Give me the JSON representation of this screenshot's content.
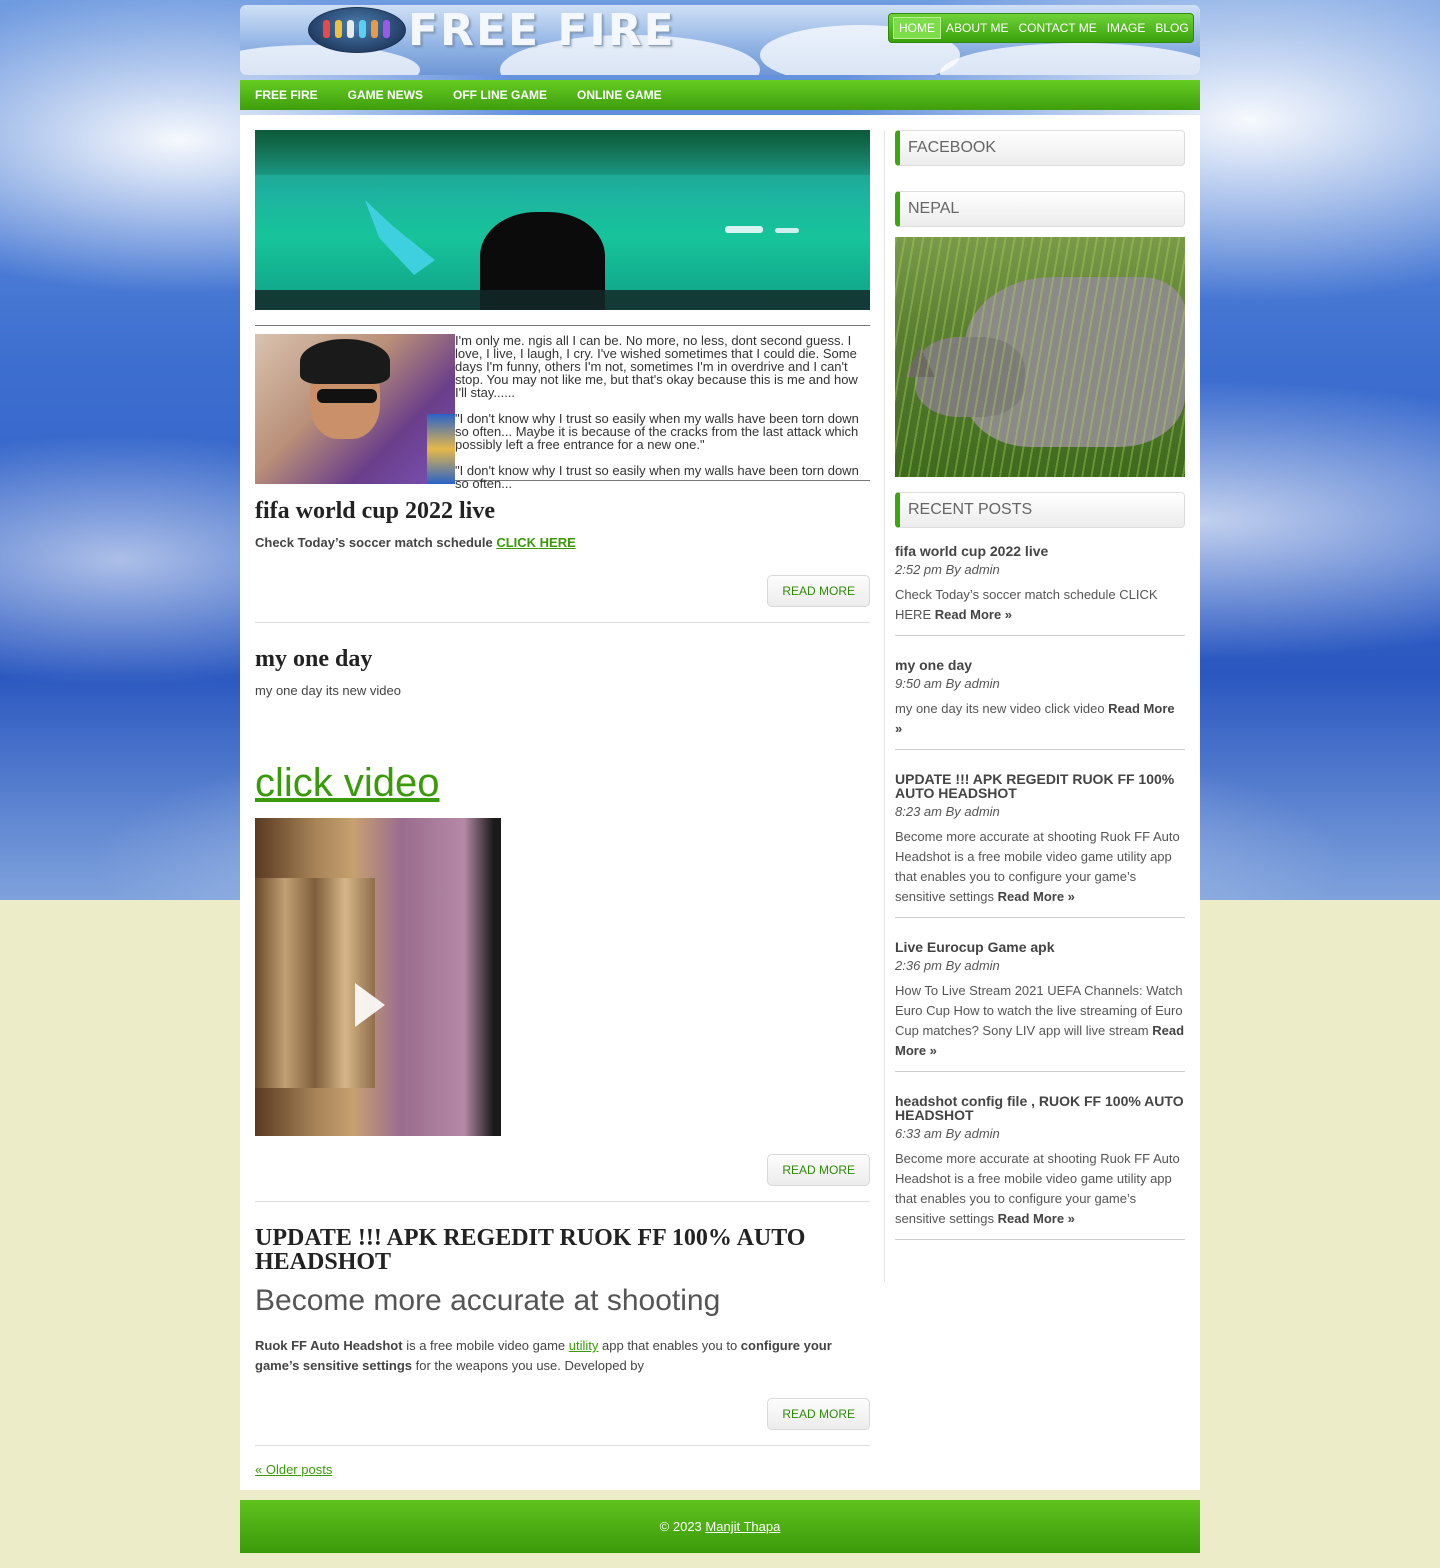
{
  "site": {
    "logo_text": "FREE FIRE",
    "top_nav": [
      "HOME",
      "ABOUT ME",
      "CONTACT ME",
      "IMAGE",
      "BLOG"
    ],
    "main_nav": [
      "FREE FIRE",
      "GAME NEWS",
      "OFF LINE GAME",
      "ONLINE GAME"
    ]
  },
  "about": {
    "paragraphs": [
      "I'm only me. ngis all I can be. No more, no less, dont second guess. I love, I live, I laugh, I cry. I've wished sometimes that I could die. Some days I'm funny, others I'm not, sometimes I'm in overdrive and I can't stop. You may not like me, but that's okay because this is me and how I'll stay......",
      "\"I don't know why I trust so easily when my walls have been torn down so often... Maybe it is because of the cracks from the last attack which possibly left a free entrance for a new one.\"",
      "\"I don't know why I trust so easily when my walls have been torn down so often..."
    ]
  },
  "posts": [
    {
      "title": "fifa world cup 2022 live",
      "text": "Check Today’s soccer match schedule ",
      "link": "CLICK HERE",
      "read_more": "READ MORE"
    },
    {
      "title": "my one day",
      "text": "my one day its new video",
      "link": "click video",
      "read_more": "READ MORE"
    },
    {
      "title": "UPDATE !!! APK REGEDIT RUOK FF 100% AUTO HEADSHOT",
      "subheading": "Become more accurate at shooting",
      "text_bold1": "Ruok FF Auto Headshot",
      "text1": " is a free mobile video game ",
      "link": "utility",
      "text2": " app that enables you to ",
      "text_bold2": "configure your game’s sensitive settings",
      "text3": " for the weapons you use. Developed by",
      "read_more": "READ MORE"
    }
  ],
  "older_posts": "« Older posts",
  "sidebar": {
    "facebook_title": "FACEBOOK",
    "nepal_title": "NEPAL",
    "recent_title": "RECENT POSTS",
    "recent": [
      {
        "title": "fifa world cup 2022 live",
        "meta": "2:52 pm By admin",
        "excerpt": "Check Today’s soccer match schedule CLICK HERE ",
        "more": "Read More »"
      },
      {
        "title": "my one day",
        "meta": "9:50 am By admin",
        "excerpt": "my one day its new video   click video ",
        "more": "Read More »"
      },
      {
        "title": "UPDATE !!! APK REGEDIT RUOK FF 100% AUTO HEADSHOT",
        "meta": "8:23 am By admin",
        "excerpt": "Become more accurate at shooting Ruok FF Auto Headshot is a free mobile video game utility app that enables you to configure your game’s sensitive settings ",
        "more": "Read More »"
      },
      {
        "title": "Live Eurocup Game apk",
        "meta": "2:36 pm By admin",
        "excerpt": "How To Live Stream 2021 UEFA Channels: Watch Euro Cup How to watch the live streaming of Euro Cup matches? Sony LIV app will live stream ",
        "more": "Read More »"
      },
      {
        "title": "headshot config file , RUOK FF 100% AUTO HEADSHOT",
        "meta": "6:33 am By admin",
        "excerpt": "Become more accurate at shooting Ruok FF Auto Headshot is a free mobile video game utility app that enables you to configure your game’s sensitive settings ",
        "more": "Read More »"
      }
    ]
  },
  "footer": {
    "copyright": "© 2023 ",
    "author": "Manjit Thapa"
  },
  "colors": {
    "accent_green": "#3e9e0c",
    "link_green": "#3a9a0a",
    "page_bg": "#ececc8"
  }
}
